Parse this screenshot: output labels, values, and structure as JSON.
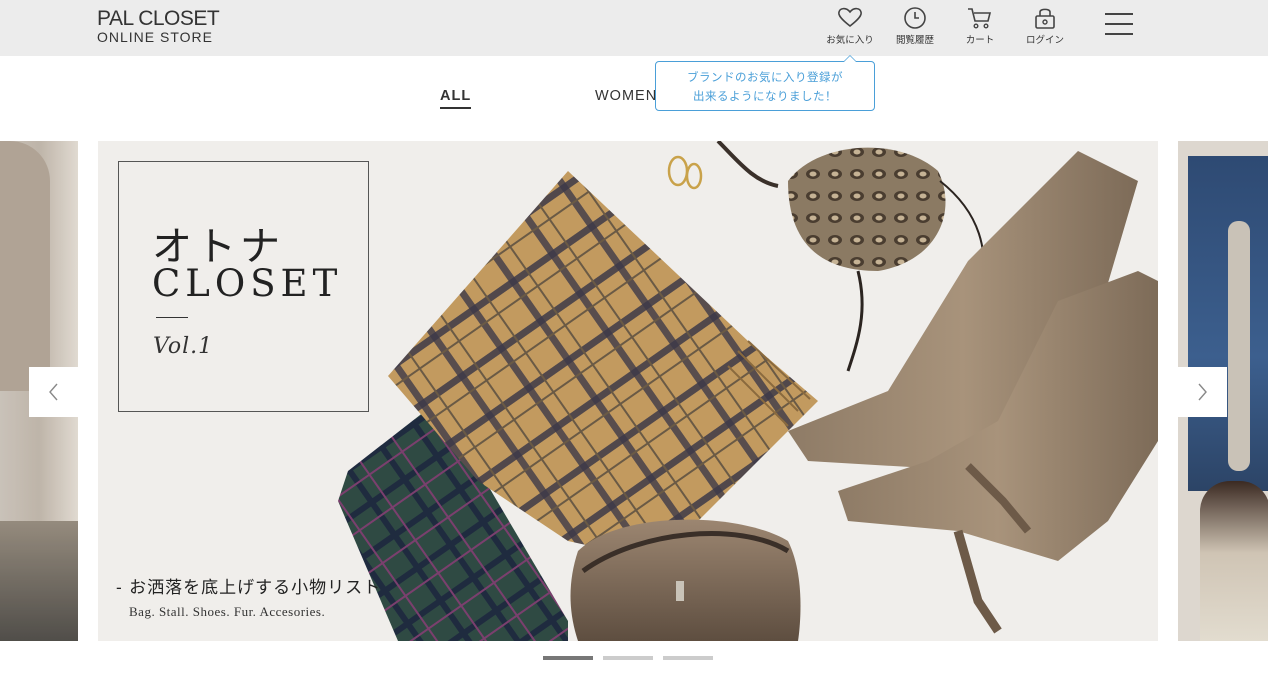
{
  "header": {
    "logo_main": "PAL CLOSET",
    "logo_sub": "ONLINE STORE",
    "icons": [
      {
        "name": "heart-icon",
        "label": "お気に入り"
      },
      {
        "name": "clock-icon",
        "label": "閲覧履歴"
      },
      {
        "name": "cart-icon",
        "label": "カート"
      },
      {
        "name": "lock-icon",
        "label": "ログイン"
      }
    ],
    "menu_icon": "hamburger-menu-icon"
  },
  "tabs": [
    {
      "label": "ALL",
      "active": true
    },
    {
      "label": "WOMEN",
      "active": false
    }
  ],
  "tooltip": {
    "line1": "ブランドのお気に入り登録が",
    "line2": "出来るようになりました！"
  },
  "banner": {
    "title_jp": "オトナ",
    "title_en": "CLOSET",
    "volume": "Vol.1",
    "caption": "- お洒落を底上げする小物リスト",
    "caption_sub": "Bag. Stall. Shoes. Fur. Accesories."
  },
  "carousel": {
    "prev_icon": "chevron-left-icon",
    "next_icon": "chevron-right-icon",
    "slide_count": 3,
    "active_index": 0
  },
  "colors": {
    "header_bg": "#ececec",
    "tooltip_accent": "#4a9fd8",
    "active_dot": "#777777",
    "inactive_dot": "#cccccc"
  }
}
